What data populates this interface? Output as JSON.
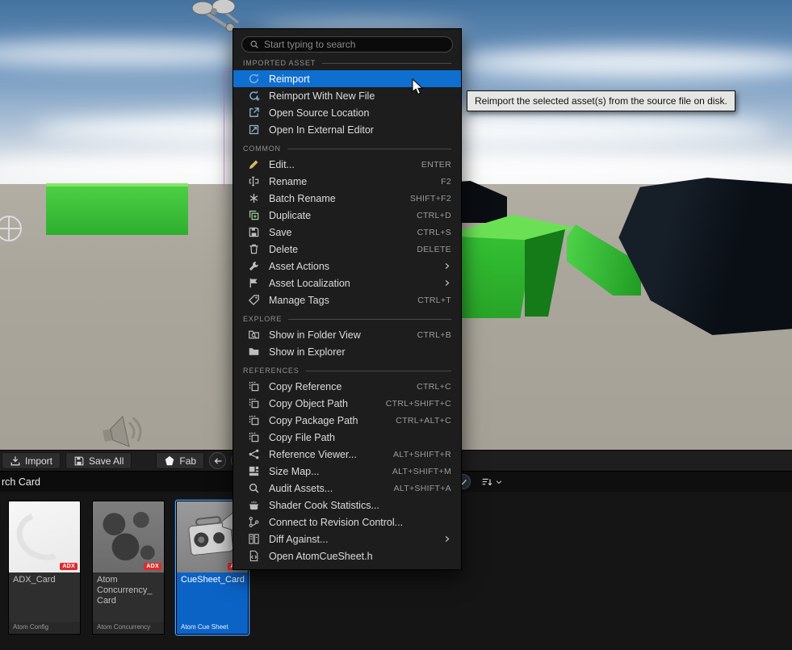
{
  "toolbar": {
    "import_label": "Import",
    "save_all_label": "Save All",
    "fab_label": "Fab",
    "icons": [
      "import-icon",
      "save-all-icon",
      "fab-logo-icon",
      "back-arrow-icon",
      "forward-arrow-icon"
    ]
  },
  "search_bar": {
    "value": "rch Card",
    "icons": [
      "filter-check-icon",
      "sort-icon",
      "chevron-down-icon"
    ]
  },
  "asset_grid": {
    "cards": [
      {
        "title": "ADX_Card",
        "asset_type": "Atom Config",
        "badge": "ADX",
        "selected": false
      },
      {
        "title": "Atom Concurrency_ Card",
        "asset_type": "Atom Concurrency",
        "badge": "ADX",
        "selected": false
      },
      {
        "title": "CueSheet_Card",
        "asset_type": "Atom Cue Sheet",
        "badge": "ADX",
        "selected": true
      }
    ]
  },
  "context_menu": {
    "search_placeholder": "Start typing to search",
    "search_icon": "search-icon",
    "sections": [
      {
        "title": "IMPORTED ASSET",
        "items": [
          {
            "label": "Reimport",
            "shortcut": "",
            "icon": "reimport-icon",
            "highlighted": true
          },
          {
            "label": "Reimport With New File",
            "shortcut": "",
            "icon": "reimport-new-file-icon"
          },
          {
            "label": "Open Source Location",
            "shortcut": "",
            "icon": "open-source-location-icon"
          },
          {
            "label": "Open In External Editor",
            "shortcut": "",
            "icon": "open-external-editor-icon"
          }
        ]
      },
      {
        "title": "COMMON",
        "items": [
          {
            "label": "Edit...",
            "shortcut": "ENTER",
            "icon": "edit-pencil-icon"
          },
          {
            "label": "Rename",
            "shortcut": "F2",
            "icon": "rename-icon"
          },
          {
            "label": "Batch Rename",
            "shortcut": "SHIFT+F2",
            "icon": "batch-rename-icon"
          },
          {
            "label": "Duplicate",
            "shortcut": "CTRL+D",
            "icon": "duplicate-icon"
          },
          {
            "label": "Save",
            "shortcut": "CTRL+S",
            "icon": "save-icon"
          },
          {
            "label": "Delete",
            "shortcut": "DELETE",
            "icon": "delete-icon"
          },
          {
            "label": "Asset Actions",
            "shortcut": "",
            "icon": "wrench-icon",
            "submenu": true
          },
          {
            "label": "Asset Localization",
            "shortcut": "",
            "icon": "flag-icon",
            "submenu": true
          },
          {
            "label": "Manage Tags",
            "shortcut": "CTRL+T",
            "icon": "tag-icon"
          }
        ]
      },
      {
        "title": "EXPLORE",
        "items": [
          {
            "label": "Show in Folder View",
            "shortcut": "CTRL+B",
            "icon": "folder-view-icon"
          },
          {
            "label": "Show in Explorer",
            "shortcut": "",
            "icon": "folder-icon"
          }
        ]
      },
      {
        "title": "REFERENCES",
        "items": [
          {
            "label": "Copy Reference",
            "shortcut": "CTRL+C",
            "icon": "copy-icon"
          },
          {
            "label": "Copy Object Path",
            "shortcut": "CTRL+SHIFT+C",
            "icon": "copy-icon"
          },
          {
            "label": "Copy Package Path",
            "shortcut": "CTRL+ALT+C",
            "icon": "copy-icon"
          },
          {
            "label": "Copy File Path",
            "shortcut": "",
            "icon": "copy-icon"
          },
          {
            "label": "Reference Viewer...",
            "shortcut": "ALT+SHIFT+R",
            "icon": "reference-viewer-icon"
          },
          {
            "label": "Size Map...",
            "shortcut": "ALT+SHIFT+M",
            "icon": "size-map-icon"
          },
          {
            "label": "Audit Assets...",
            "shortcut": "ALT+SHIFT+A",
            "icon": "audit-assets-icon"
          },
          {
            "label": "Shader Cook Statistics...",
            "shortcut": "",
            "icon": "shader-cook-icon"
          },
          {
            "label": "Connect to Revision Control...",
            "shortcut": "",
            "icon": "revision-control-icon"
          },
          {
            "label": "Diff Against...",
            "shortcut": "",
            "icon": "diff-icon",
            "submenu": true
          },
          {
            "label": "Open AtomCueSheet.h",
            "shortcut": "",
            "icon": "code-file-icon"
          }
        ]
      }
    ]
  },
  "tooltip": {
    "text": "Reimport the selected asset(s) from the source file on disk."
  }
}
